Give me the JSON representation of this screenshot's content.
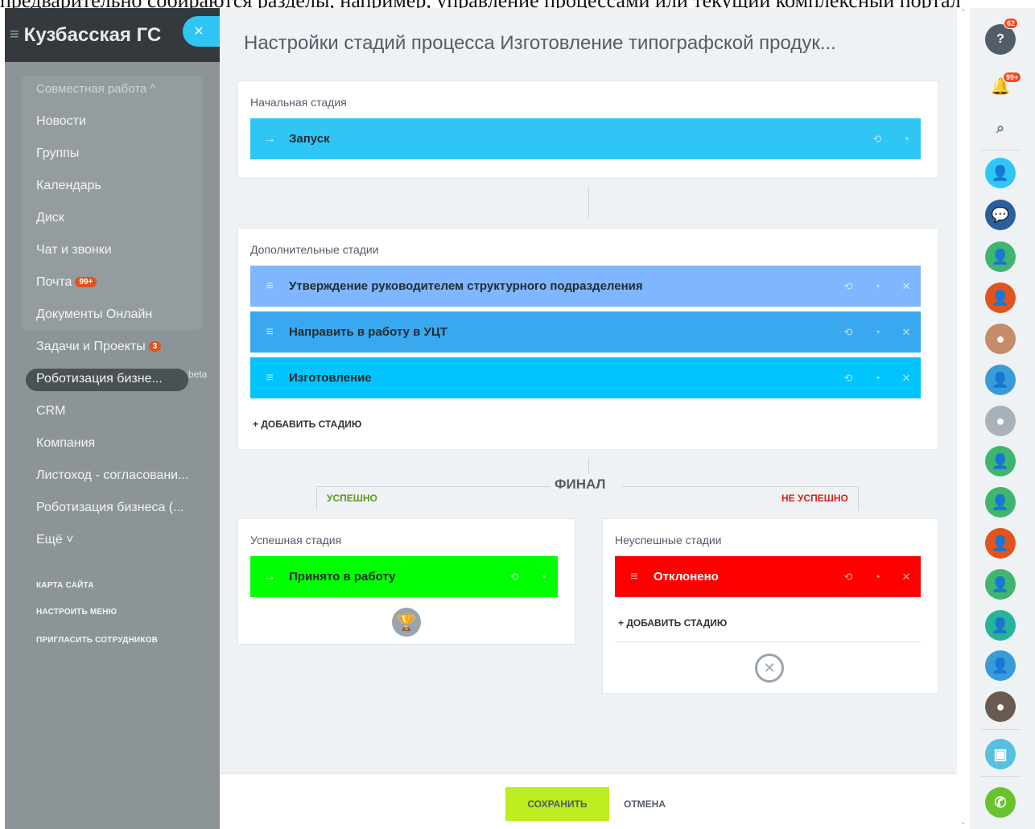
{
  "top_strip_text": "предварительно собираются разделы, например, управление процессами или текущий комплексный портал",
  "sidebar": {
    "title": "Кузбасская ГС",
    "section": "Совместная работа ^",
    "items": [
      {
        "label": "Новости"
      },
      {
        "label": "Группы"
      },
      {
        "label": "Календарь"
      },
      {
        "label": "Диск"
      },
      {
        "label": "Чат и звонки"
      },
      {
        "label": "Почта",
        "badge": "99+"
      },
      {
        "label": "Документы Онлайн"
      },
      {
        "label": "Задачи и Проекты",
        "badge": "3"
      },
      {
        "label": "Роботизация бизне...",
        "tag": "beta"
      },
      {
        "label": "CRM"
      },
      {
        "label": "Компания"
      },
      {
        "label": "Листоход - согласовани..."
      },
      {
        "label": "Роботизация бизнеса (..."
      },
      {
        "label": "Ещё ˅"
      }
    ],
    "links": [
      "КАРТА САЙТА",
      "НАСТРОИТЬ МЕНЮ",
      "ПРИГЛАСИТЬ СОТРУДНИКОВ"
    ]
  },
  "page": {
    "title": "Настройки стадий процесса Изготовление типографской продук..."
  },
  "initial": {
    "label": "Начальная стадия",
    "stage": {
      "name": "Запуск",
      "color": "#2fc6f6"
    }
  },
  "extra": {
    "label": "Дополнительные стадии",
    "stages": [
      {
        "name": "Утверждение руководителем структурного подразделения",
        "color": "#80b6ff"
      },
      {
        "name": "Направить в работу в УЦТ",
        "color": "#39a8ef"
      },
      {
        "name": "Изготовление",
        "color": "#00c4fb"
      }
    ],
    "add_label": "+ ДОБАВИТЬ СТАДИЮ"
  },
  "final": {
    "title": "ФИНАЛ",
    "success_label": "УСПЕШНО",
    "fail_label": "НЕ УСПЕШНО"
  },
  "success": {
    "label": "Успешная стадия",
    "stage": {
      "name": "Принято в работу",
      "color": "#00ff00"
    }
  },
  "failure": {
    "label": "Неуспешные стадии",
    "stage": {
      "name": "Отклонено",
      "color": "#ff0000"
    },
    "add_label": "+ ДОБАВИТЬ СТАДИЮ"
  },
  "footer": {
    "save_label": "СОХРАНИТЬ",
    "cancel_label": "ОТМЕНА"
  },
  "right_panel": {
    "help_badge": "62",
    "notifications_badge": "99+"
  },
  "colors": {
    "save_button": "#bbed21",
    "success_text": "#5a9a16",
    "fail_text": "#d8201c"
  }
}
